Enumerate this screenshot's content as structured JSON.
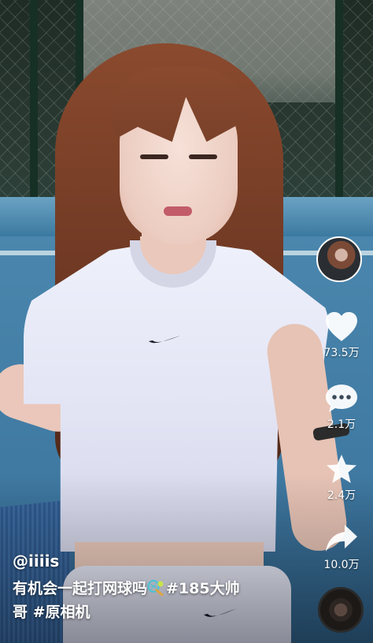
{
  "video": {
    "scene": "tennis-court-selfie-video"
  },
  "actions": {
    "like_count": "73.5万",
    "comment_count": "2.1万",
    "favorite_count": "2.4万",
    "share_count": "10.0万"
  },
  "caption": {
    "author": "@iiiis",
    "text": "有机会一起打网球吗",
    "emoji": "tennis-racket-icon",
    "hashtag1": "#185大帅",
    "hashtag1_cont": "哥",
    "hashtag2": "#原相机"
  },
  "colors": {
    "accent": "#ffffff",
    "court": "#4a86ad"
  }
}
